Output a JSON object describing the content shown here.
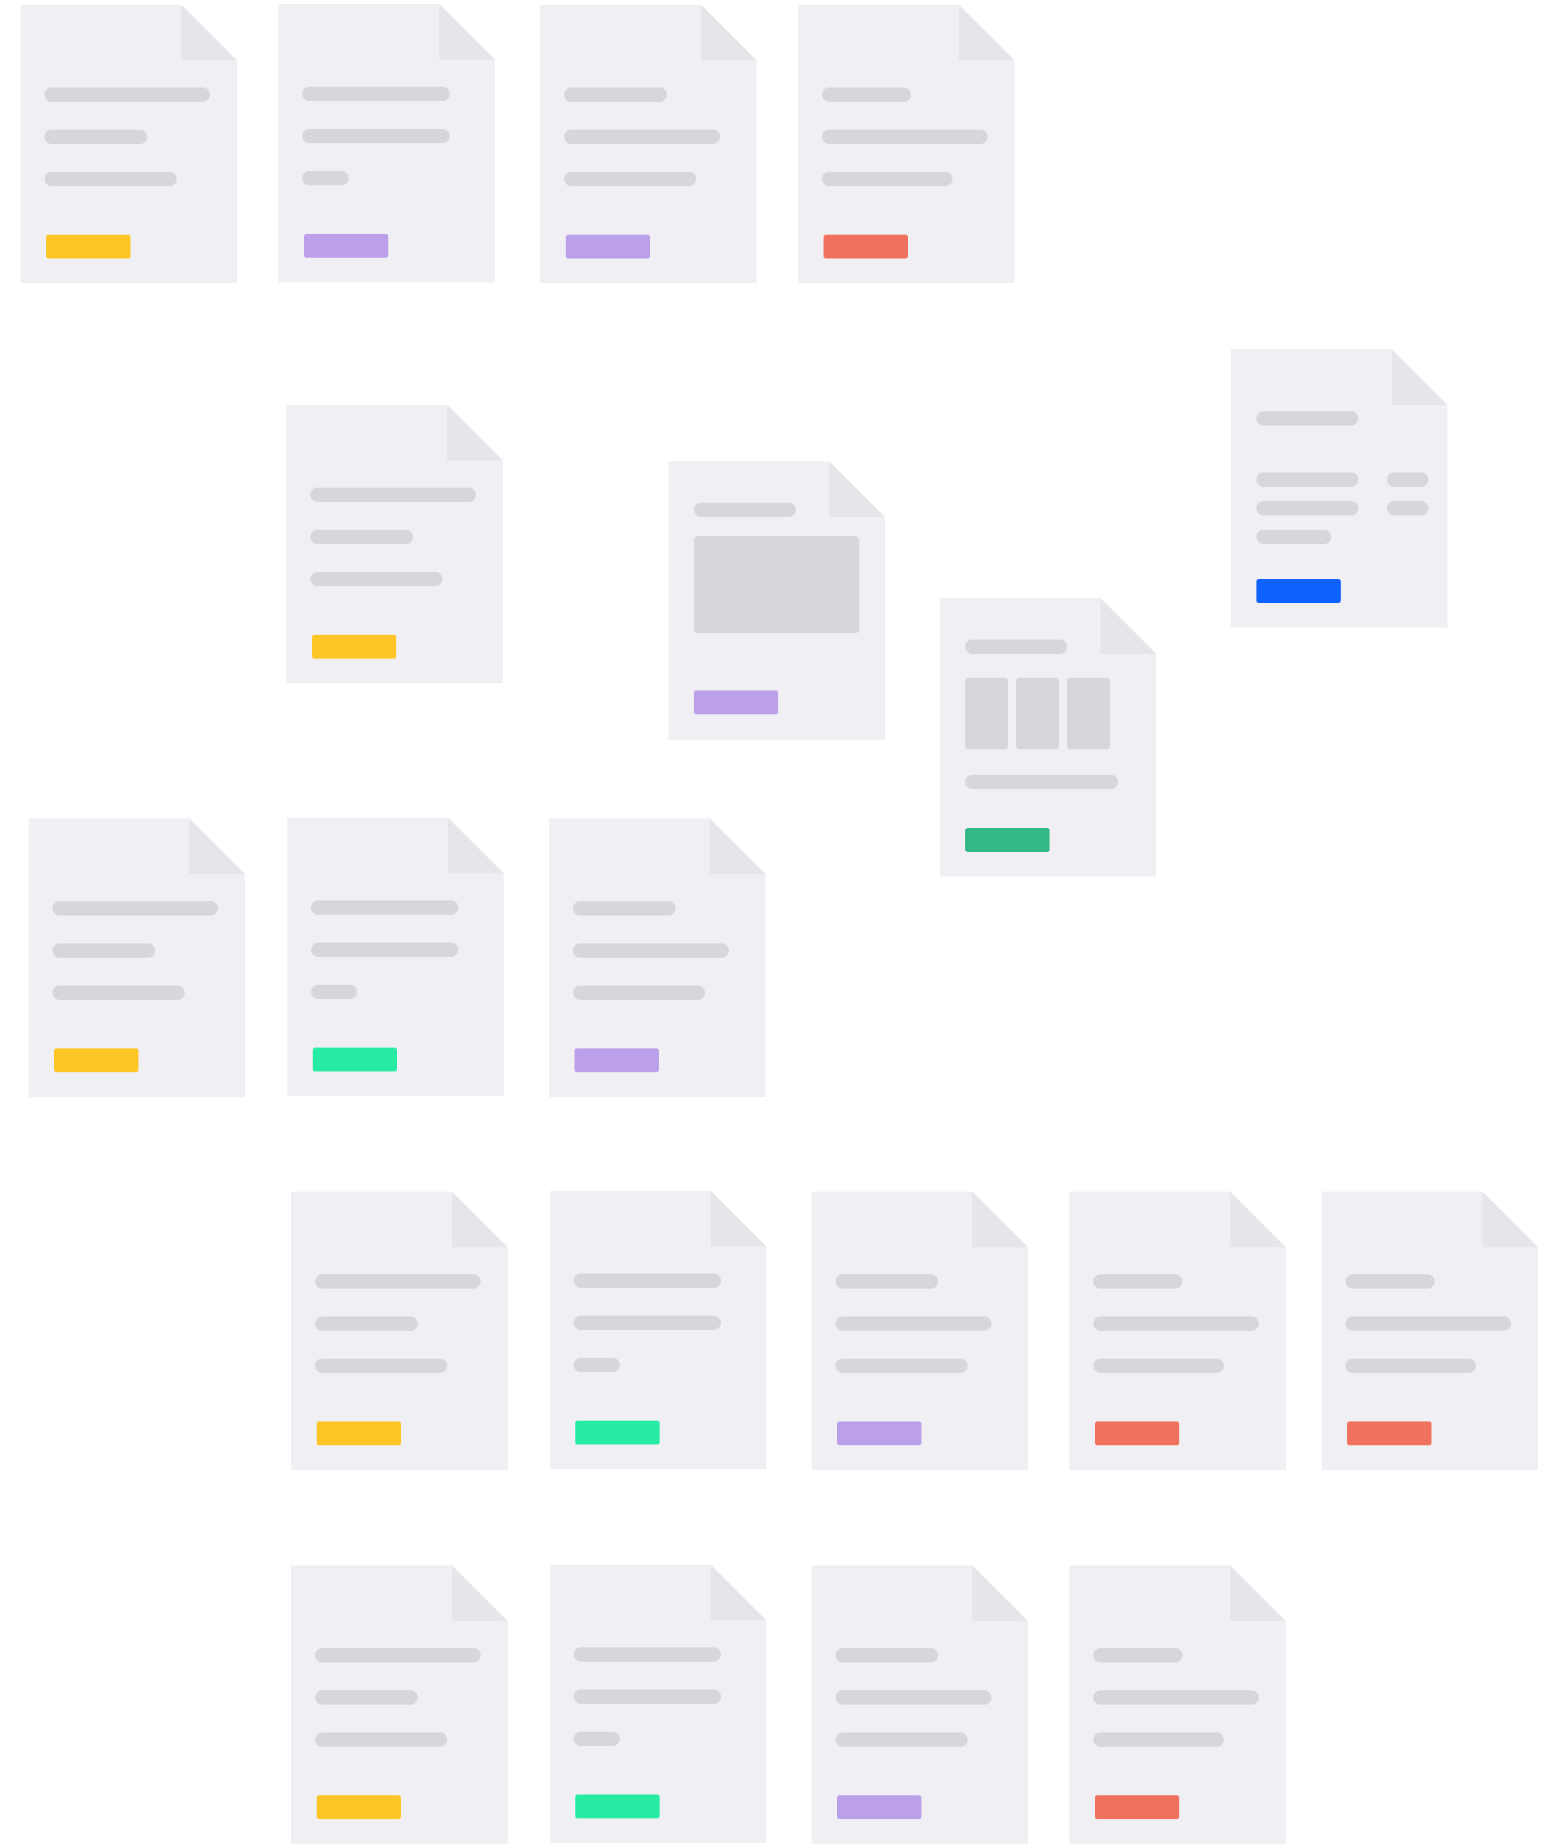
{
  "colors": {
    "page": "#f0f0f4",
    "fold": "#e5e6ea",
    "placeholder": "#d6d7db",
    "tag": {
      "yellow": "#fec527",
      "purple": "#bb9fe9",
      "red": "#f0715e",
      "green": "#28eba3",
      "teal": "#32b884",
      "blue": "#0f61ff"
    }
  },
  "documents": [
    {
      "layout": "lines",
      "lines": [
        1.0,
        0.62,
        0.8
      ],
      "tag": "yellow"
    },
    {
      "layout": "lines",
      "lines": [
        0.89,
        0.89,
        0.28
      ],
      "tag": "purple"
    },
    {
      "layout": "lines",
      "lines": [
        0.62,
        0.94,
        0.8
      ],
      "tag": "purple"
    },
    {
      "layout": "lines",
      "lines": [
        0.54,
        1.0,
        0.79
      ],
      "tag": "red"
    },
    {
      "layout": "lines",
      "lines": [
        1.0,
        0.62,
        0.8
      ],
      "tag": "yellow"
    },
    {
      "layout": "hero-image",
      "tag": "purple"
    },
    {
      "layout": "three-columns",
      "tag": "teal"
    },
    {
      "layout": "list",
      "tag": "blue"
    },
    {
      "layout": "lines",
      "lines": [
        1.0,
        0.62,
        0.8
      ],
      "tag": "yellow"
    },
    {
      "layout": "lines",
      "lines": [
        0.89,
        0.89,
        0.28
      ],
      "tag": "green"
    },
    {
      "layout": "lines",
      "lines": [
        0.62,
        0.94,
        0.8
      ],
      "tag": "purple"
    },
    {
      "layout": "lines",
      "lines": [
        1.0,
        0.62,
        0.8
      ],
      "tag": "yellow"
    },
    {
      "layout": "lines",
      "lines": [
        0.89,
        0.89,
        0.28
      ],
      "tag": "green"
    },
    {
      "layout": "lines",
      "lines": [
        0.62,
        0.94,
        0.8
      ],
      "tag": "purple"
    },
    {
      "layout": "lines",
      "lines": [
        0.54,
        1.0,
        0.79
      ],
      "tag": "red"
    },
    {
      "layout": "lines",
      "lines": [
        0.54,
        1.0,
        0.79
      ],
      "tag": "red"
    },
    {
      "layout": "lines",
      "lines": [
        1.0,
        0.62,
        0.8
      ],
      "tag": "yellow"
    },
    {
      "layout": "lines",
      "lines": [
        0.89,
        0.89,
        0.28
      ],
      "tag": "green"
    },
    {
      "layout": "lines",
      "lines": [
        0.62,
        0.94,
        0.8
      ],
      "tag": "purple"
    },
    {
      "layout": "lines",
      "lines": [
        0.54,
        1.0,
        0.79
      ],
      "tag": "red"
    }
  ]
}
